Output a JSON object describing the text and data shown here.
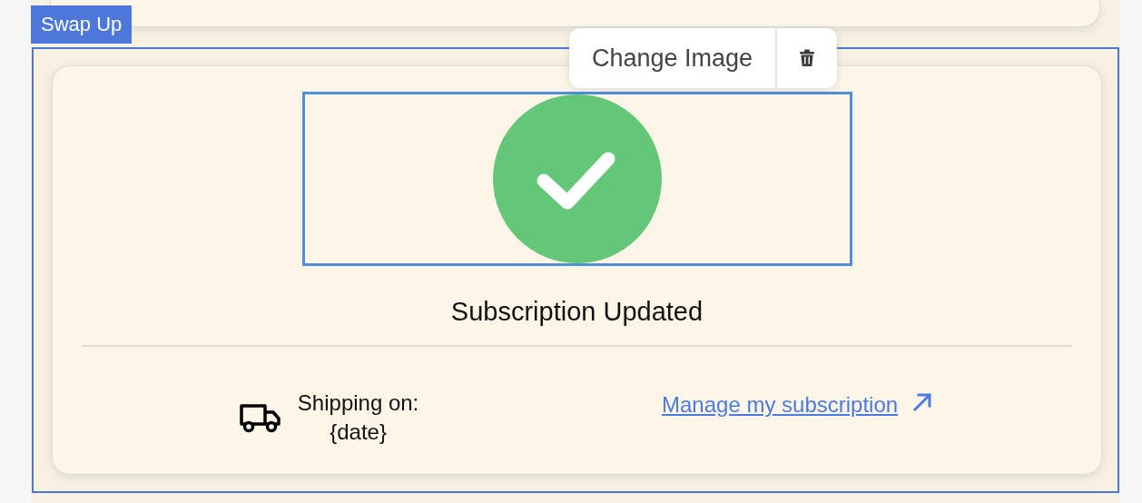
{
  "swap_label": "Swap Up",
  "toolbar": {
    "button": "Change Image"
  },
  "image": {
    "selected": true
  },
  "title": "Subscription Updated",
  "shipping": {
    "label": "Shipping on:",
    "date": "{date}"
  },
  "link": "Manage my subscription"
}
